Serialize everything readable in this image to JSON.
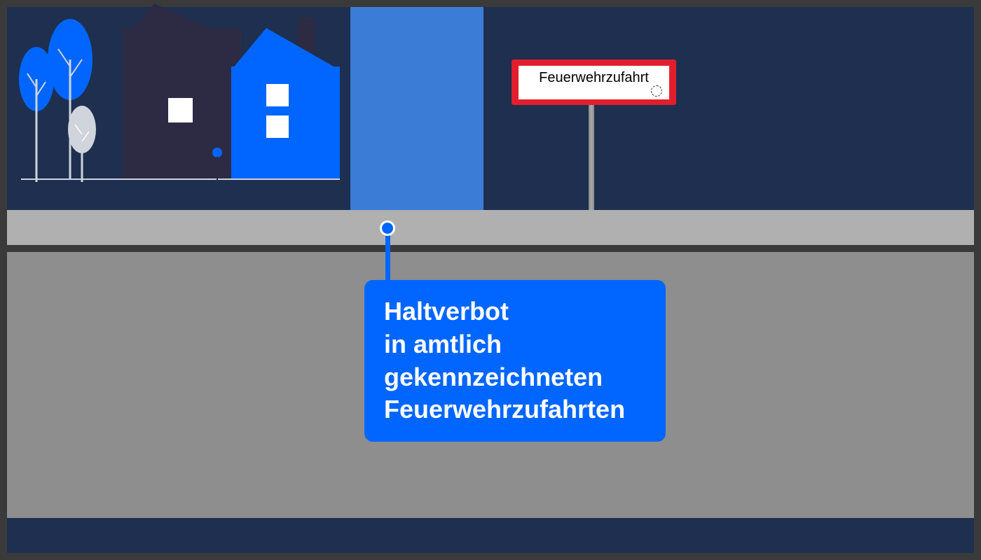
{
  "sign": {
    "label": "Feuerwehrzufahrt"
  },
  "callout": {
    "line1": "Haltverbot",
    "line2": "in amtlich",
    "line3": "gekennzeichneten",
    "line4": "Feuerwehrzufahrten"
  },
  "colors": {
    "accent": "#0066ff",
    "sign_border": "#e21e2d",
    "bg_dark": "#1e2f4f"
  }
}
